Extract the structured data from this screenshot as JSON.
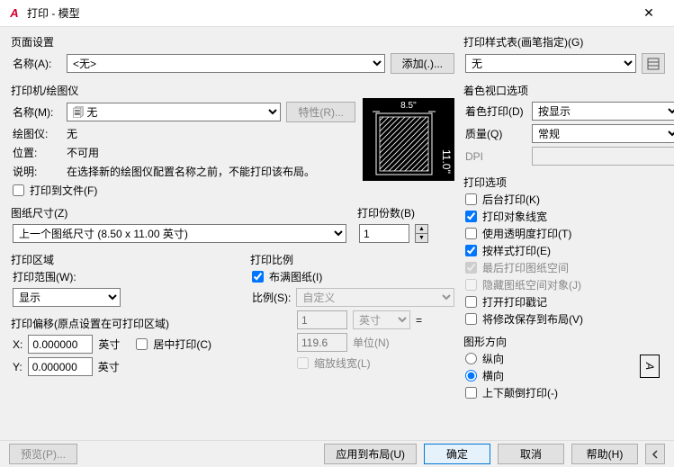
{
  "title": "打印 - 模型",
  "pageSetup": {
    "legend": "页面设置",
    "nameLabel": "名称(A):",
    "nameValue": "<无>",
    "addBtn": "添加(.)..."
  },
  "printer": {
    "legend": "打印机/绘图仪",
    "nameLabel": "名称(M):",
    "nameValue": "🗐 无",
    "propsBtn": "特性(R)...",
    "plotterLabel": "绘图仪:",
    "plotterValue": "无",
    "locLabel": "位置:",
    "locValue": "不可用",
    "descLabel": "说明:",
    "descValue": "在选择新的绘图仪配置名称之前，不能打印该布局。",
    "toFile": "打印到文件(F)",
    "previewTop": "8.5''"
  },
  "paper": {
    "legend": "图纸尺寸(Z)",
    "value": "上一个图纸尺寸 (8.50 x 11.00 英寸)"
  },
  "copies": {
    "legend": "打印份数(B)",
    "value": "1"
  },
  "area": {
    "legend": "打印区域",
    "rangeLabel": "打印范围(W):",
    "rangeValue": "显示"
  },
  "scale": {
    "legend": "打印比例",
    "fit": "布满图纸(I)",
    "scaleLabel": "比例(S):",
    "scaleValue": "自定义",
    "n1": "1",
    "u1": "英寸",
    "eq": "=",
    "n2": "119.6",
    "u2": "单位(N)",
    "scaleLine": "缩放线宽(L)"
  },
  "offset": {
    "legend": "打印偏移(原点设置在可打印区域)",
    "x": "X:",
    "y": "Y:",
    "xv": "0.000000",
    "yv": "0.000000",
    "unit": "英寸",
    "center": "居中打印(C)"
  },
  "styleTable": {
    "legend": "打印样式表(画笔指定)(G)",
    "value": "无"
  },
  "viewport": {
    "legend": "着色视口选项",
    "shadeLabel": "着色打印(D)",
    "shadeValue": "按显示",
    "qualityLabel": "质量(Q)",
    "qualityValue": "常规",
    "dpi": "DPI"
  },
  "options": {
    "legend": "打印选项",
    "bg": "后台打印(K)",
    "lw": "打印对象线宽",
    "trans": "使用透明度打印(T)",
    "style": "按样式打印(E)",
    "last": "最后打印图纸空间",
    "hide": "隐藏图纸空间对象(J)",
    "stamp": "打开打印戳记",
    "save": "将修改保存到布局(V)"
  },
  "orient": {
    "legend": "图形方向",
    "portrait": "纵向",
    "landscape": "横向",
    "upside": "上下颠倒打印(-)",
    "A": "A"
  },
  "footer": {
    "preview": "预览(P)...",
    "apply": "应用到布局(U)",
    "ok": "确定",
    "cancel": "取消",
    "help": "帮助(H)"
  }
}
